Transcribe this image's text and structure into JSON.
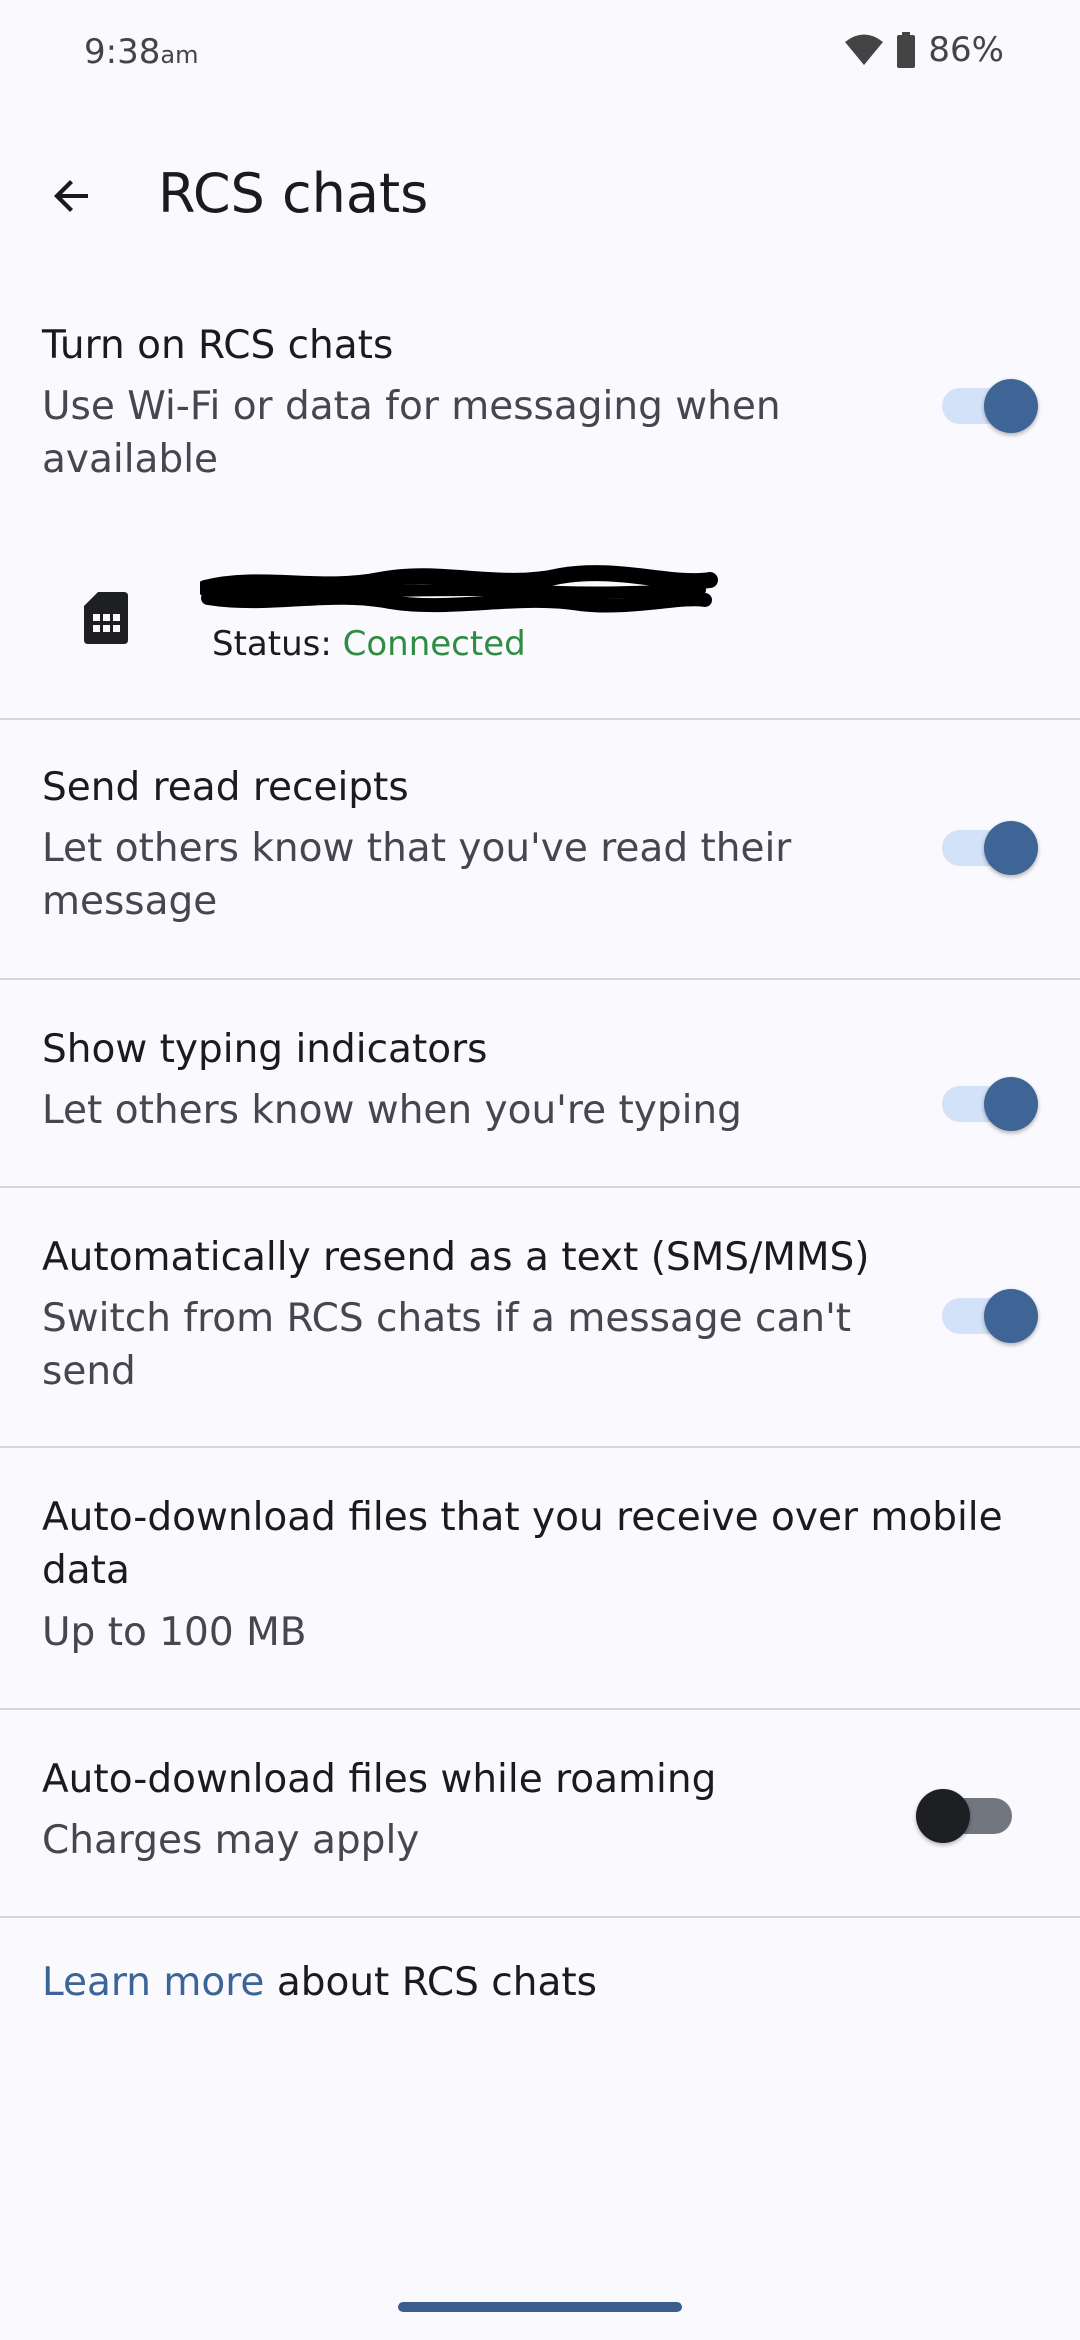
{
  "status_bar": {
    "time": "9:38",
    "ampm": "am",
    "battery_percent": "86%",
    "icons": [
      "wifi-icon",
      "battery-icon"
    ]
  },
  "app_bar": {
    "back_icon": "arrow-back-icon",
    "title": "RCS chats"
  },
  "settings": {
    "rcs": {
      "title": "Turn on RCS chats",
      "subtitle_line1": "Use Wi-Fi or data for messaging when",
      "subtitle_line2": "available",
      "enabled": true
    },
    "sim": {
      "icon": "sim-card-icon",
      "status_label": "Status:",
      "status_value": "Connected"
    },
    "read_receipts": {
      "title": "Send read receipts",
      "subtitle_line1": "Let others know that you've read their",
      "subtitle_line2": "message",
      "enabled": true
    },
    "typing": {
      "title": "Show typing indicators",
      "subtitle": "Let others know when you're typing",
      "enabled": true
    },
    "resend": {
      "title": "Automatically resend as a text (SMS/MMS)",
      "subtitle_line1": "Switch from RCS chats if a message can't",
      "subtitle_line2": "send",
      "enabled": true
    },
    "auto_download_mobile": {
      "title_line1": "Auto-download files that you receive over mobile",
      "title_line2": "data",
      "subtitle": "Up to 100 MB"
    },
    "auto_download_roaming": {
      "title": "Auto-download files while roaming",
      "subtitle": "Charges may apply",
      "enabled": false
    }
  },
  "footer": {
    "link_text": "Learn more",
    "text": " about RCS chats"
  },
  "colors": {
    "background": "#FAF9FE",
    "accent": "#3F6597",
    "toggle_track_on": "#D3E1F9",
    "connected": "#2F8C45",
    "link": "#3B6498"
  }
}
